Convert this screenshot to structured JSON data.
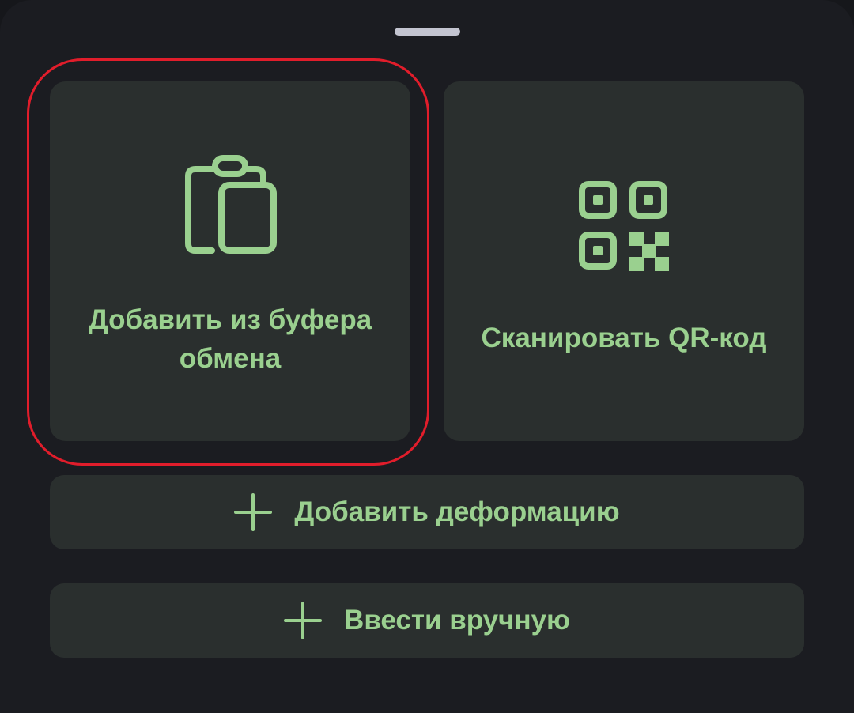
{
  "sheet": {
    "cards": {
      "clipboard": {
        "label": "Добавить из буфера обмена",
        "icon": "clipboard-icon"
      },
      "qr": {
        "label": "Сканировать QR-код",
        "icon": "qr-code-icon"
      }
    },
    "buttons": {
      "add_deformation": {
        "label": "Добавить деформацию",
        "icon": "plus-icon"
      },
      "manual_entry": {
        "label": "Ввести вручную",
        "icon": "plus-icon"
      }
    }
  },
  "colors": {
    "sheet_background": "#1b1c21",
    "card_background": "#2a2f2e",
    "accent": "#9ad08f",
    "highlight": "#e11d2b",
    "handle": "#c3c4d0"
  }
}
